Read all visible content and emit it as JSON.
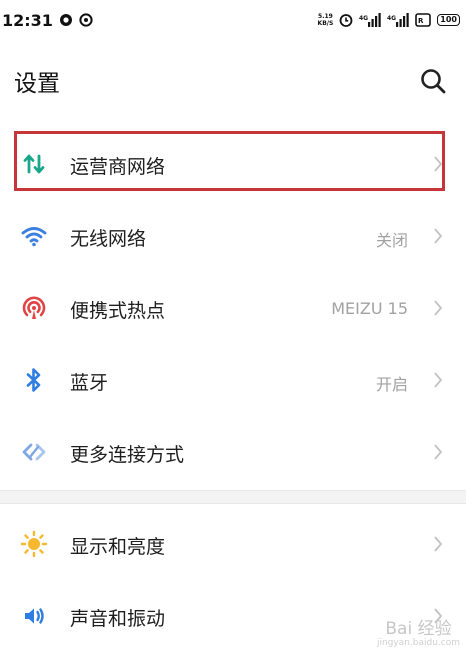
{
  "status_bar": {
    "time": "12:31",
    "speed_value": "5.19",
    "speed_unit": "KB/S",
    "battery": "100"
  },
  "header": {
    "title": "设置",
    "search_icon": "search-icon"
  },
  "settings_group_1": [
    {
      "label": "运营商网络",
      "value": "",
      "icon": "mobile-data-icon",
      "color": "#1aa68a",
      "highlighted": true
    },
    {
      "label": "无线网络",
      "value": "关闭",
      "icon": "wifi-icon",
      "color": "#3b7fe0"
    },
    {
      "label": "便携式热点",
      "value": "MEIZU 15",
      "icon": "hotspot-icon",
      "color": "#e04545"
    },
    {
      "label": "蓝牙",
      "value": "开启",
      "icon": "bluetooth-icon",
      "color": "#2f7de1"
    },
    {
      "label": "更多连接方式",
      "value": "",
      "icon": "link-icon",
      "color": "#7ea7e3"
    }
  ],
  "settings_group_2": [
    {
      "label": "显示和亮度",
      "value": "",
      "icon": "brightness-icon",
      "color": "#f5b82e"
    },
    {
      "label": "声音和振动",
      "value": "",
      "icon": "sound-icon",
      "color": "#2f7de1"
    }
  ],
  "watermark": {
    "text": "Bai 经验",
    "sub": "jingyan.baidu.com"
  }
}
